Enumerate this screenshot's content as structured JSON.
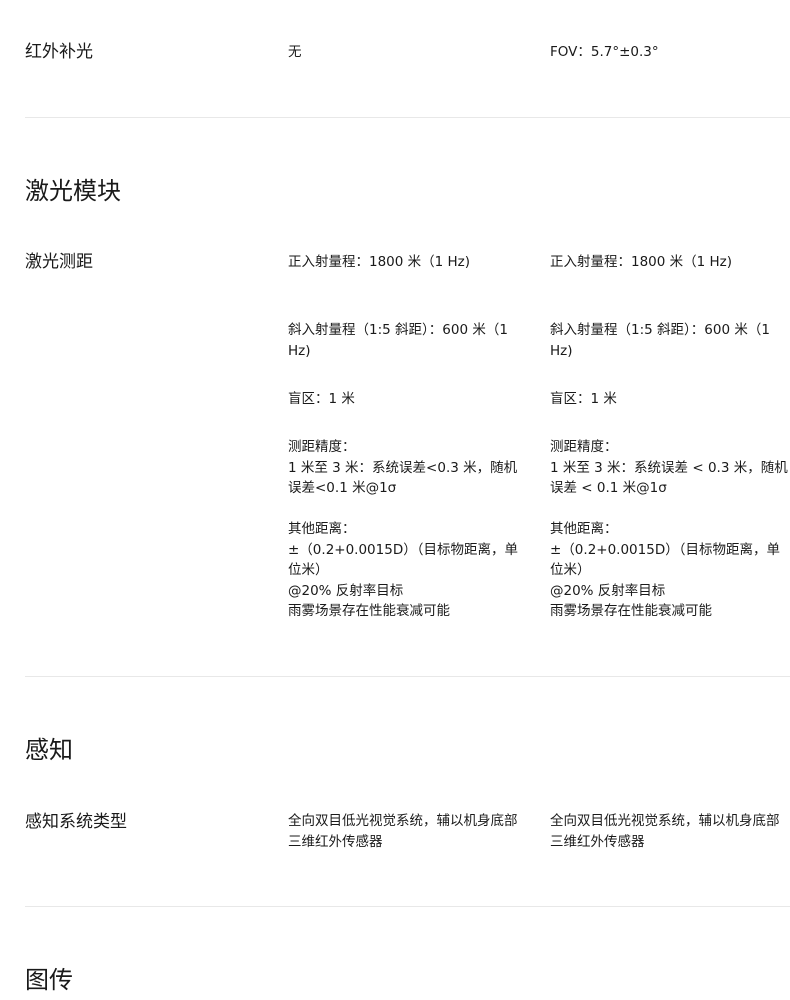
{
  "rows": {
    "ir_fill": {
      "label": "红外补光",
      "col_a": [
        "无"
      ],
      "col_b": [
        "FOV：5.7°±0.3°"
      ]
    },
    "laser_ranging": {
      "label": "激光测距",
      "col_a": {
        "range_direct": "正入射量程：1800 米（1 Hz)",
        "range_oblique": "斜入射量程（1:5 斜距）：600 米（1 Hz)",
        "blind_zone": "盲区：1 米",
        "accuracy_title": "测距精度：",
        "accuracy_text": "1 米至 3 米：系统误差<0.3 米，随机误差<0.1 米@1σ",
        "other_title": "其他距离：",
        "other_formula": "±（0.2+0.0015D）（目标物距离，单位米）",
        "other_reflect": "@20% 反射率目标",
        "other_weather": "雨雾场景存在性能衰减可能"
      },
      "col_b": {
        "range_direct": "正入射量程：1800 米（1 Hz)",
        "range_oblique": "斜入射量程（1:5 斜距）：600 米（1 Hz)",
        "blind_zone": "盲区：1 米",
        "accuracy_title": "测距精度：",
        "accuracy_text": "1 米至 3 米：系统误差 < 0.3 米，随机误差 < 0.1 米@1σ",
        "other_title": "其他距离：",
        "other_formula": "±（0.2+0.0015D）（目标物距离，单位米）",
        "other_reflect": "@20% 反射率目标",
        "other_weather": "雨雾场景存在性能衰减可能"
      }
    },
    "perception_type": {
      "label": "感知系统类型",
      "col_a": "全向双目低光视觉系统，辅以机身底部三维红外传感器",
      "col_b": "全向双目低光视觉系统，辅以机身底部三维红外传感器"
    }
  },
  "sections": {
    "laser_module": "激光模块",
    "perception": "感知",
    "image_transmission": "图传"
  }
}
